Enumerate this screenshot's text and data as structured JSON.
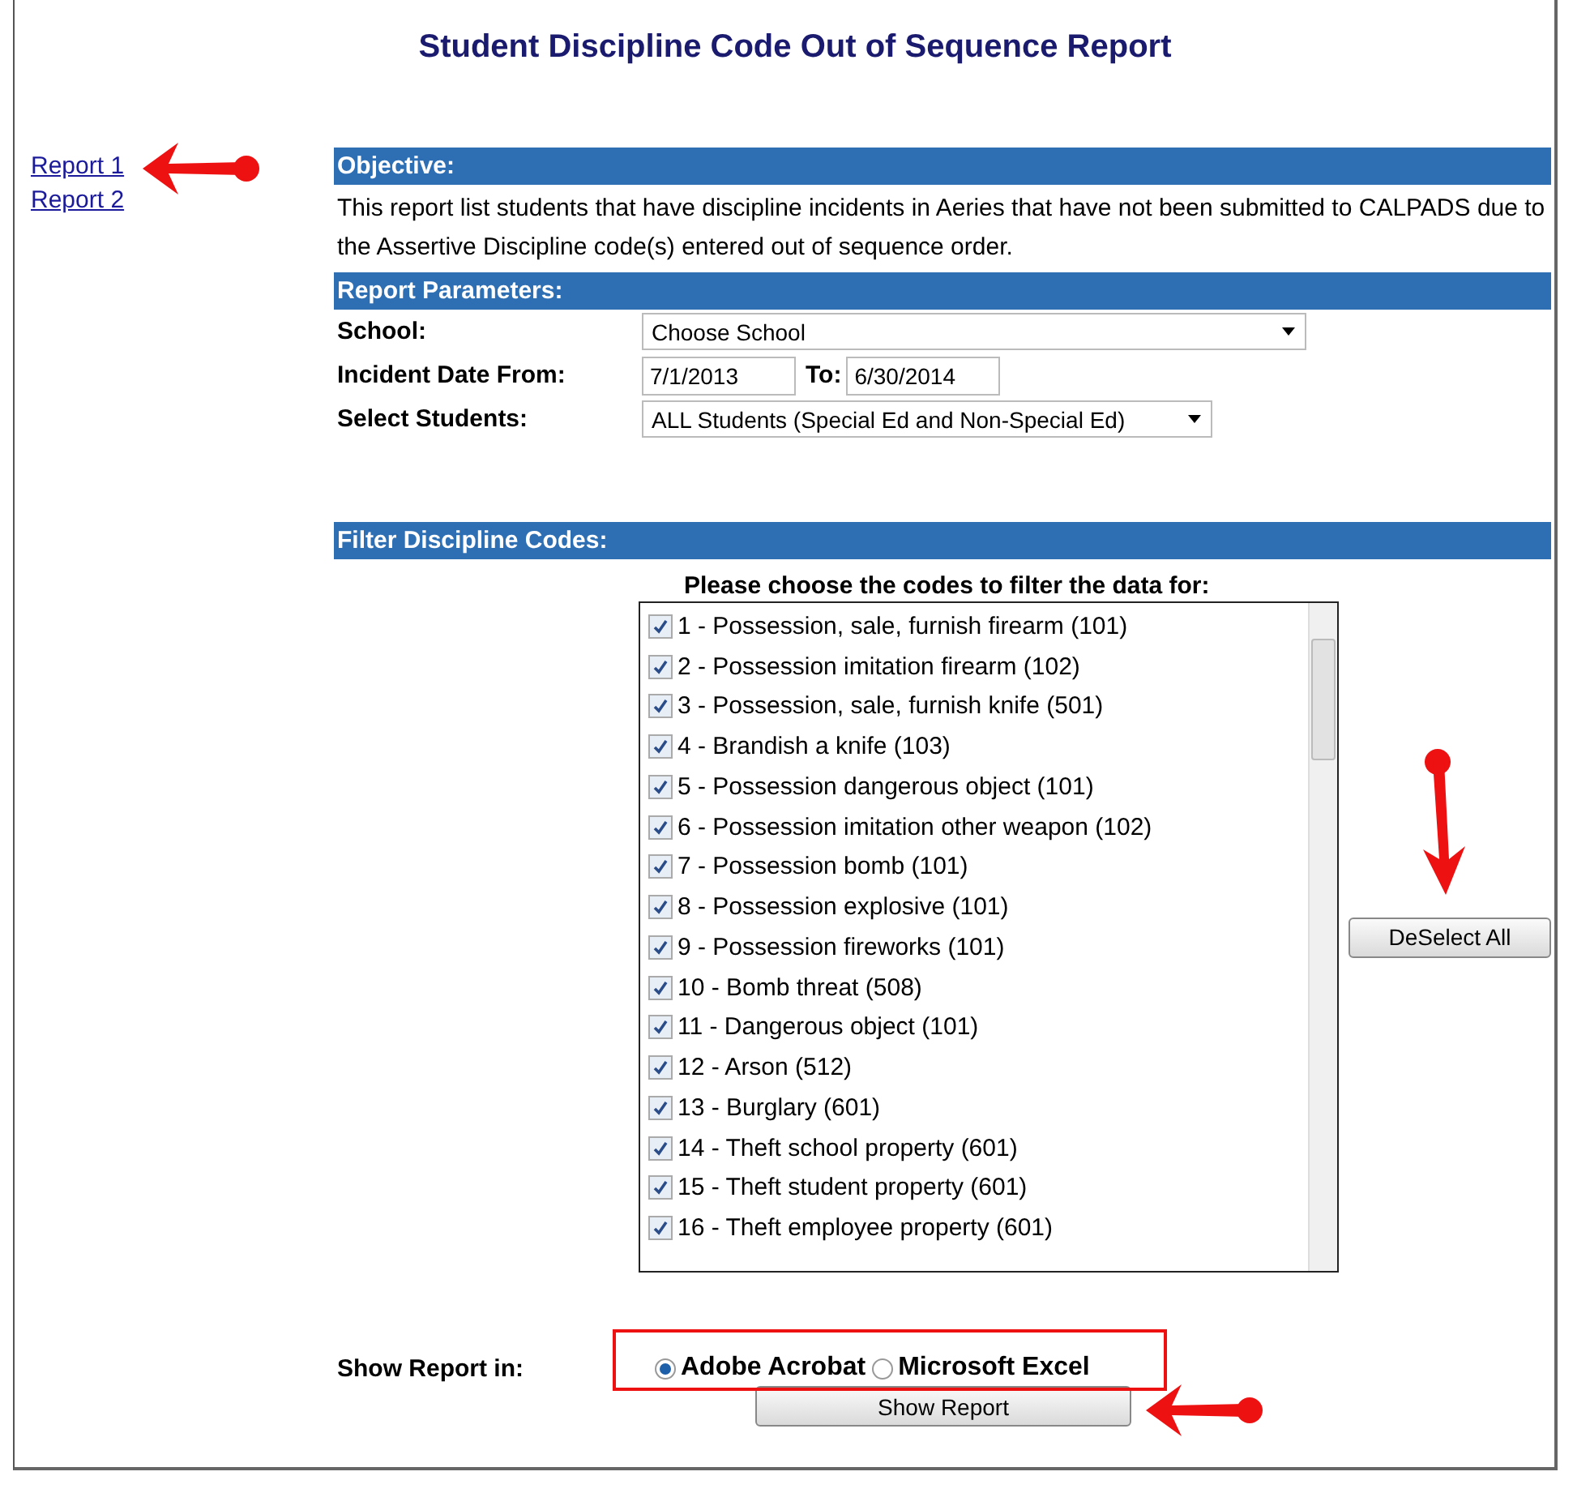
{
  "title": "Student Discipline Code Out of Sequence Report",
  "sidebar": {
    "links": [
      "Report 1",
      "Report 2"
    ]
  },
  "objective": {
    "heading": "Objective:",
    "text": "This report list students that have discipline incidents in Aeries that have not been submitted to CALPADS due to the Assertive Discipline code(s) entered out of sequence order."
  },
  "parameters": {
    "heading": "Report Parameters:",
    "school": {
      "label": "School:",
      "value": "Choose School"
    },
    "incident_date": {
      "label": "Incident Date From:",
      "from": "7/1/2013",
      "to_label": "To:",
      "to": "6/30/2014"
    },
    "students": {
      "label": "Select Students:",
      "value": "ALL Students (Special Ed and Non-Special Ed)"
    }
  },
  "filter": {
    "heading": "Filter Discipline Codes:",
    "prompt": "Please choose the codes to filter the data for:",
    "deselect_button": "DeSelect All",
    "codes": [
      {
        "label": "1 - Possession, sale, furnish firearm (101)",
        "checked": true
      },
      {
        "label": "2 - Possession imitation firearm (102)",
        "checked": true
      },
      {
        "label": "3 - Possession, sale, furnish knife (501)",
        "checked": true
      },
      {
        "label": "4 - Brandish a knife (103)",
        "checked": true
      },
      {
        "label": "5 - Possession dangerous object (101)",
        "checked": true
      },
      {
        "label": "6 - Possession imitation other weapon (102)",
        "checked": true
      },
      {
        "label": "7 - Possession bomb (101)",
        "checked": true
      },
      {
        "label": "8 - Possession explosive (101)",
        "checked": true
      },
      {
        "label": "9 - Possession fireworks (101)",
        "checked": true
      },
      {
        "label": "10 - Bomb threat (508)",
        "checked": true
      },
      {
        "label": "11 - Dangerous object (101)",
        "checked": true
      },
      {
        "label": "12 - Arson (512)",
        "checked": true
      },
      {
        "label": "13 - Burglary (601)",
        "checked": true
      },
      {
        "label": "14 - Theft school property (601)",
        "checked": true
      },
      {
        "label": "15 - Theft student property (601)",
        "checked": true
      },
      {
        "label": "16 - Theft employee property (601)",
        "checked": true
      }
    ]
  },
  "output": {
    "label": "Show Report in:",
    "formats": [
      {
        "label": "Adobe Acrobat",
        "selected": true
      },
      {
        "label": "Microsoft Excel",
        "selected": false
      }
    ],
    "button": "Show Report"
  }
}
